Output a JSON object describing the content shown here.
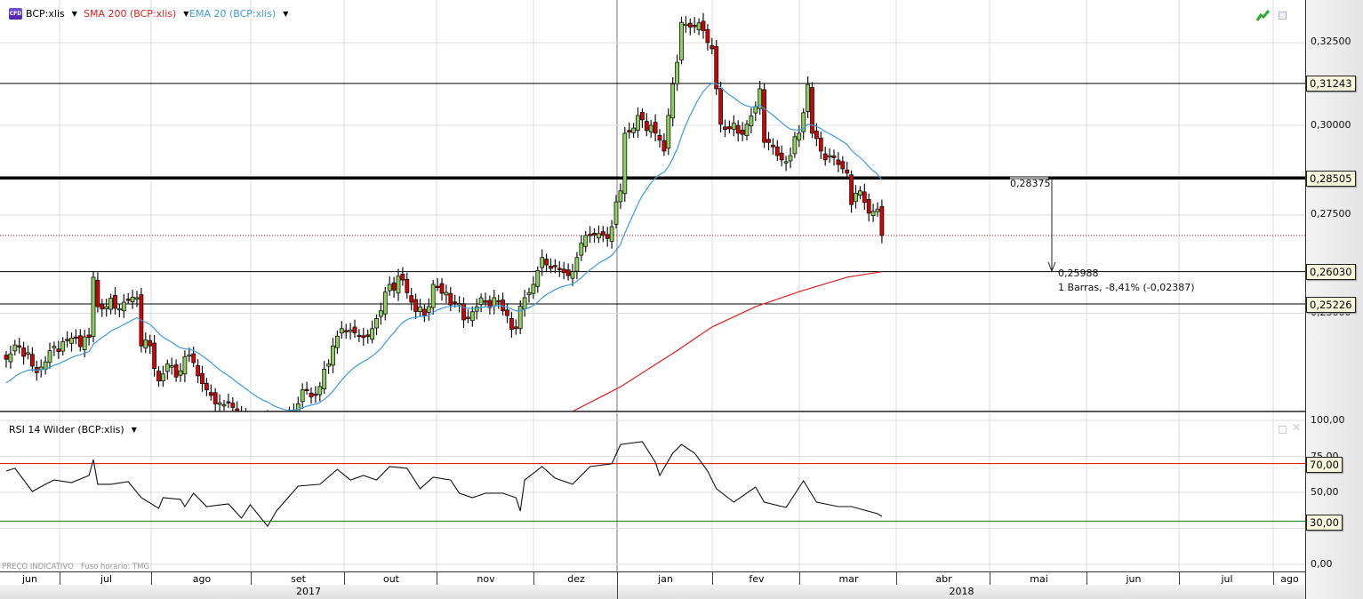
{
  "legend": {
    "symbol_badge": "CFD",
    "symbol": "BCP:xlis",
    "sma": "SMA 200 (BCP:xlis)",
    "ema": "EMA 20 (BCP:xlis)",
    "sma_color": "#e02020",
    "ema_color": "#3d9be0",
    "symbol_icon": "cfd-badge-icon",
    "chart_type_icon": "green-line-chart-icon"
  },
  "rsi_panel": {
    "title": "RSI 14 Wilder (BCP:xlis)"
  },
  "footer": {
    "indicative": "PREÇO INDICATIVO",
    "timezone": "Fuso horário: TMG"
  },
  "price_axis": {
    "ticks": [
      "0,32500",
      "0,30000",
      "0,27500",
      "0,25000"
    ]
  },
  "rsi_axis": {
    "ticks": [
      "100,00",
      "75,00",
      "50,00",
      "0,00"
    ]
  },
  "levels": {
    "l1": "0,31243",
    "l2": "0,28505",
    "l3": "0,26030",
    "l4": "0,25226",
    "rsi_high": "70,00",
    "rsi_low": "30,00"
  },
  "measurement": {
    "start": "0,28375",
    "end": "0,25988",
    "summary": "1 Barras, -8,41% (-0,02387)"
  },
  "x_axis": {
    "months": [
      "jun",
      "jul",
      "ago",
      "set",
      "out",
      "nov",
      "dez",
      "jan",
      "fev",
      "mar",
      "abr",
      "mai",
      "jun",
      "jul",
      "ago"
    ],
    "years": [
      "2017",
      "2018"
    ]
  },
  "chart_data": [
    {
      "type": "candlestick",
      "title": "BCP:xlis",
      "scale": "log",
      "ylim": [
        0.2273,
        0.3388
      ],
      "x_unit": "trading day index (0 = early Jun 2017)",
      "close_keypoints": [
        [
          0,
          0.2391
        ],
        [
          3,
          0.2422
        ],
        [
          7,
          0.236
        ],
        [
          10,
          0.2411
        ],
        [
          13,
          0.2432
        ],
        [
          19,
          0.2442
        ],
        [
          20,
          0.2589
        ],
        [
          21,
          0.2516
        ],
        [
          23,
          0.2516
        ],
        [
          27,
          0.2527
        ],
        [
          30,
          0.2538
        ],
        [
          31,
          0.2422
        ],
        [
          33,
          0.2422
        ],
        [
          35,
          0.2341
        ],
        [
          37,
          0.238
        ],
        [
          39,
          0.235
        ],
        [
          42,
          0.2401
        ],
        [
          46,
          0.2321
        ],
        [
          49,
          0.2292
        ],
        [
          52,
          0.2282
        ],
        [
          55,
          0.2252
        ],
        [
          58,
          0.2243
        ],
        [
          64,
          0.2243
        ],
        [
          68,
          0.2321
        ],
        [
          71,
          0.2311
        ],
        [
          74,
          0.238
        ],
        [
          75,
          0.2422
        ],
        [
          77,
          0.2463
        ],
        [
          80,
          0.2453
        ],
        [
          82,
          0.2442
        ],
        [
          84,
          0.2463
        ],
        [
          86,
          0.2506
        ],
        [
          88,
          0.2571
        ],
        [
          91,
          0.2582
        ],
        [
          93,
          0.2527
        ],
        [
          96,
          0.2495
        ],
        [
          98,
          0.2571
        ],
        [
          100,
          0.2549
        ],
        [
          103,
          0.2527
        ],
        [
          105,
          0.2484
        ],
        [
          108,
          0.2516
        ],
        [
          112,
          0.2538
        ],
        [
          114,
          0.2506
        ],
        [
          117,
          0.2463
        ],
        [
          119,
          0.2538
        ],
        [
          121,
          0.2571
        ],
        [
          123,
          0.2639
        ],
        [
          126,
          0.2617
        ],
        [
          129,
          0.2593
        ],
        [
          131,
          0.2639
        ],
        [
          133,
          0.2696
        ],
        [
          137,
          0.2696
        ],
        [
          139,
          0.2719
        ],
        [
          141,
          0.2815
        ],
        [
          142,
          0.2977
        ],
        [
          146,
          0.3016
        ],
        [
          149,
          0.2977
        ],
        [
          151,
          0.2926
        ],
        [
          152,
          0.3029
        ],
        [
          154,
          0.3189
        ],
        [
          155,
          0.3315
        ],
        [
          158,
          0.3301
        ],
        [
          160,
          0.3288
        ],
        [
          162,
          0.3231
        ],
        [
          163,
          0.3108
        ],
        [
          164,
          0.3003
        ],
        [
          166,
          0.299
        ],
        [
          168,
          0.2977
        ],
        [
          170,
          0.3003
        ],
        [
          172,
          0.3055
        ],
        [
          173,
          0.3108
        ],
        [
          174,
          0.2951
        ],
        [
          176,
          0.2938
        ],
        [
          178,
          0.2901
        ],
        [
          180,
          0.2913
        ],
        [
          182,
          0.2977
        ],
        [
          184,
          0.3121
        ],
        [
          185,
          0.2977
        ],
        [
          187,
          0.2926
        ],
        [
          189,
          0.2913
        ],
        [
          191,
          0.2888
        ],
        [
          193,
          0.2864
        ],
        [
          194,
          0.2778
        ],
        [
          196,
          0.2815
        ],
        [
          198,
          0.2755
        ],
        [
          200,
          0.2766
        ],
        [
          201,
          0.2696
        ]
      ],
      "current_price_line": 0.2696,
      "horizontal_levels": [
        0.31243,
        0.28505,
        0.2603,
        0.25226
      ]
    },
    {
      "type": "line",
      "name": "SMA 200 (BCP:xlis)",
      "points": [
        [
          130,
          0.2273
        ],
        [
          141,
          0.2328
        ],
        [
          154,
          0.2411
        ],
        [
          162,
          0.2467
        ],
        [
          172,
          0.2516
        ],
        [
          182,
          0.2553
        ],
        [
          193,
          0.2589
        ],
        [
          201,
          0.2603
        ]
      ]
    },
    {
      "type": "line",
      "name": "EMA 20 (BCP:xlis)",
      "period": 20
    },
    {
      "type": "line",
      "name": "RSI 14 Wilder (BCP:xlis)",
      "ylim": [
        0,
        100
      ],
      "reference_lines": [
        70,
        30
      ],
      "points": [
        [
          0,
          64.8
        ],
        [
          2,
          66.7
        ],
        [
          6,
          50.6
        ],
        [
          9,
          55.6
        ],
        [
          11,
          58.6
        ],
        [
          15,
          56.8
        ],
        [
          19,
          61.7
        ],
        [
          20,
          72.8
        ],
        [
          21,
          55.6
        ],
        [
          24,
          55.6
        ],
        [
          28,
          57.4
        ],
        [
          31,
          46.3
        ],
        [
          35,
          38.9
        ],
        [
          36,
          46.3
        ],
        [
          40,
          45.1
        ],
        [
          41,
          40.1
        ],
        [
          43,
          49.4
        ],
        [
          46,
          40.1
        ],
        [
          51,
          42.0
        ],
        [
          54,
          32.1
        ],
        [
          56,
          41.4
        ],
        [
          60,
          26.5
        ],
        [
          62,
          37.0
        ],
        [
          67,
          54.3
        ],
        [
          72,
          55.6
        ],
        [
          76,
          66.0
        ],
        [
          79,
          58.6
        ],
        [
          82,
          61.7
        ],
        [
          85,
          58.6
        ],
        [
          88,
          67.9
        ],
        [
          92,
          66.7
        ],
        [
          95,
          52.5
        ],
        [
          98,
          60.5
        ],
        [
          102,
          58.6
        ],
        [
          104,
          49.4
        ],
        [
          107,
          46.3
        ],
        [
          110,
          49.4
        ],
        [
          114,
          49.4
        ],
        [
          117,
          46.3
        ],
        [
          118,
          37.0
        ],
        [
          119,
          58.6
        ],
        [
          123,
          67.9
        ],
        [
          126,
          59.9
        ],
        [
          130,
          55.6
        ],
        [
          134,
          67.9
        ],
        [
          139,
          69.8
        ],
        [
          141,
          83.3
        ],
        [
          146,
          85.2
        ],
        [
          149,
          71.0
        ],
        [
          150,
          61.7
        ],
        [
          153,
          77.2
        ],
        [
          155,
          83.3
        ],
        [
          158,
          77.2
        ],
        [
          161,
          64.8
        ],
        [
          163,
          52.5
        ],
        [
          167,
          43.2
        ],
        [
          172,
          53.7
        ],
        [
          174,
          43.2
        ],
        [
          179,
          39.5
        ],
        [
          183,
          58.0
        ],
        [
          186,
          43.2
        ],
        [
          191,
          40.1
        ],
        [
          194,
          40.1
        ],
        [
          200,
          35.2
        ],
        [
          201,
          33.3
        ]
      ]
    }
  ]
}
